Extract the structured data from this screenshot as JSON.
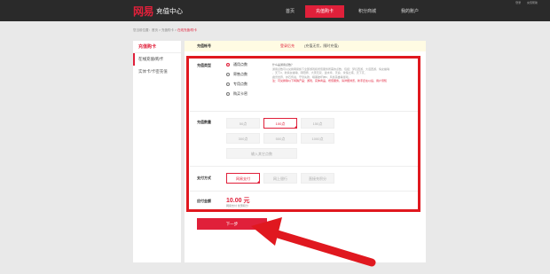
{
  "header": {
    "brand": "网易",
    "title": "充值中心",
    "top_links": [
      "登录",
      "充值帮助"
    ],
    "nav": [
      "首页",
      "充值购卡",
      "积分商城",
      "我的账户"
    ],
    "nav_active": 1
  },
  "breadcrumb": {
    "prefix": "您当前位置：",
    "items": [
      "首页",
      "充值购卡",
      "在线充值/购卡"
    ],
    "sep": " > "
  },
  "sidebar": {
    "title": "充值购卡",
    "items": [
      "在线充值/购卡",
      "实体卡/卡密充值"
    ],
    "active": 0
  },
  "account": {
    "label": "充值帐号",
    "value": "登录后充",
    "note": "(充值无忧，随时充值)"
  },
  "recharge_type": {
    "label": "充值类型",
    "options": [
      "通用点数",
      "寄售点数",
      "专用点数",
      "购买卡密"
    ],
    "selected": 0,
    "desc_head": "什么是通用点数？",
    "desc_lines": [
      "通用点数可以兑换网易旗下全部游戏和增值服务所需的点数，包括：梦幻西游、大话西游、倩女幽魂",
      "、天下3、新倩女幽魂、阴阳师、大唐无双、逆水寒、天谕、永恒之塔、天下贰、",
      "魔兽世界、炉石传说、守望先锋、暗黑破坏神3、风暴英雄等游戏。"
    ],
    "desc_red": "注：可兑换除以下特殊产品：游戏、实体商品、增值服务，请详细浏览，新手还在以后，用户须知"
  },
  "quantity": {
    "label": "充值数量",
    "options": [
      "50点",
      "100点",
      "150点",
      "300点",
      "500点",
      "1000点"
    ],
    "selected": 1,
    "custom": "输入其它点数"
  },
  "payment": {
    "label": "支付方式",
    "options": [
      "网易支付",
      "网上银行",
      "直接充积分"
    ],
    "selected": 0
  },
  "total": {
    "label": "应付金额",
    "amount": "10.00 元",
    "note": "网易支付 优惠积分"
  },
  "next_button": "下一步",
  "colors": {
    "accent": "#e0203a",
    "highlight_frame": "#e0181f",
    "topbar": "#2a2a2a"
  }
}
